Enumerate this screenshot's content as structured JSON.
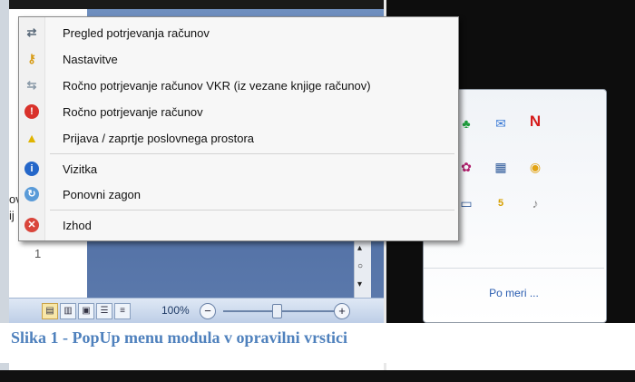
{
  "menu": {
    "items": [
      {
        "label": "Pregled potrjevanja računov",
        "icon": "review-icon"
      },
      {
        "label": "Nastavitve",
        "icon": "settings-key-icon"
      },
      {
        "label": "Ročno potrjevanje računov VKR (iz vezane knjige računov)",
        "icon": "manual-vkr-icon"
      },
      {
        "label": "Ročno potrjevanje računov",
        "icon": "manual-confirm-icon"
      },
      {
        "label": "Prijava / zaprtje poslovnega prostora",
        "icon": "warning-icon"
      },
      {
        "label": "Vizitka",
        "icon": "info-icon"
      },
      {
        "label": "Ponovni zagon",
        "icon": "restart-icon"
      },
      {
        "label": "Izhod",
        "icon": "exit-icon"
      }
    ]
  },
  "document": {
    "fragment1": "ov",
    "fragment2": "ij",
    "line_number": "1"
  },
  "statusbar": {
    "zoom": "100%",
    "zoom_out": "−",
    "zoom_in": "+"
  },
  "tray": {
    "link": "Po meri ...",
    "n_label": "N",
    "badge": "5"
  },
  "caption": "Slika 1 - PopUp menu modula v opravilni vrstici",
  "colors": {
    "caption": "#4f81bd",
    "menu_bg": "#f7f7f7",
    "link": "#2a5db0"
  }
}
